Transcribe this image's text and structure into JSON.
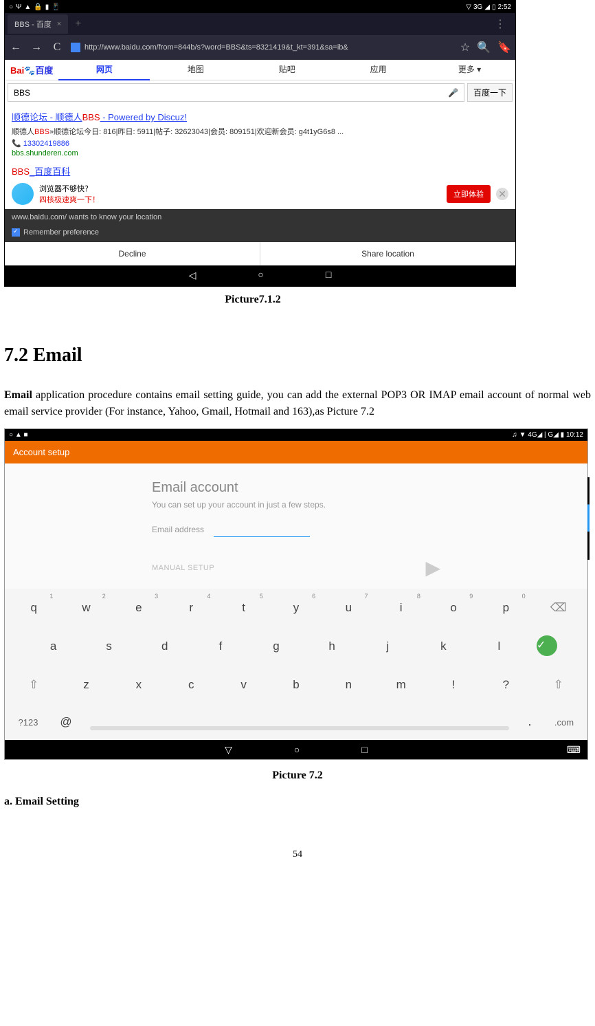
{
  "screenshot1": {
    "status": {
      "time": "2:52",
      "network": "3G",
      "icons_left": [
        "o-icon",
        "psi-icon",
        "warn-icon",
        "lock-icon",
        "battery-icon",
        "phone-icon"
      ]
    },
    "tab": {
      "title": "BBS - 百度",
      "close": "×",
      "new": "+",
      "menu": "⋮"
    },
    "url": {
      "back": "←",
      "forward": "→",
      "reload": "C",
      "text": "http://www.baidu.com/from=844b/s?word=BBS&ts=8321419&t_kt=391&sa=ib&",
      "star": "☆",
      "search": "🔍",
      "bookmark": "🔖"
    },
    "baidu": {
      "logo": {
        "bai": "Bai",
        "du": "百度",
        "paw": "🐾"
      },
      "nav": [
        "网页",
        "地图",
        "贴吧",
        "应用",
        "更多"
      ],
      "more_arrow": "▾",
      "search_value": "BBS",
      "mic": "🎤",
      "search_btn": "百度一下"
    },
    "result1": {
      "title_p1": "顺德论坛 - 顺德人",
      "title_red": "BBS",
      "title_p2": " - Powered by Discuz!",
      "snippet_pre": "顺德人",
      "snippet_red": "BBS",
      "snippet_post": "»顺德论坛今日: 816|昨日: 5911|帖子: 32623043|会员: 809151|欢迎新会员: g4t1yG6s8 ...",
      "phone": "13302419886",
      "url": "bbs.shunderen.com"
    },
    "result2": {
      "red": "BBS",
      "blue": "_百度百科"
    },
    "promo": {
      "line1": "浏览器不够快？",
      "line2": "四核极速爽一下！",
      "btn": "立即体验",
      "close": "✕"
    },
    "location": {
      "text": "www.baidu.com/ wants to know your location",
      "pref": "Remember preference",
      "decline": "Decline",
      "share": "Share location"
    },
    "nav": {
      "back": "◁",
      "home": "○",
      "recent": "□"
    }
  },
  "caption1": "Picture7.1.2",
  "heading": "7.2 Email",
  "body": {
    "strong": "Email",
    "rest": " application procedure contains email setting guide, you can add the external POP3 OR IMAP email account of normal web email service provider (For instance, Yahoo, Gmail, Hotmail and 163),as Picture 7.2"
  },
  "screenshot2": {
    "status": {
      "left_icons": "○ ▲ ■",
      "right": "♫ ▼ 4G◢ | G◢ ▮ 10:12"
    },
    "header": "Account setup",
    "card": {
      "title": "Email account",
      "sub": "You can set up your account in just a few steps.",
      "field": "Email address",
      "manual": "MANUAL SETUP",
      "next": "▶"
    },
    "keyboard": {
      "row1": [
        {
          "k": "q",
          "n": "1"
        },
        {
          "k": "w",
          "n": "2"
        },
        {
          "k": "e",
          "n": "3"
        },
        {
          "k": "r",
          "n": "4"
        },
        {
          "k": "t",
          "n": "5"
        },
        {
          "k": "y",
          "n": "6"
        },
        {
          "k": "u",
          "n": "7"
        },
        {
          "k": "i",
          "n": "8"
        },
        {
          "k": "o",
          "n": "9"
        },
        {
          "k": "p",
          "n": "0"
        }
      ],
      "backspace": "⌫",
      "row2": [
        "a",
        "s",
        "d",
        "f",
        "g",
        "h",
        "j",
        "k",
        "l"
      ],
      "enter": "✓",
      "shift": "⇧",
      "row3": [
        "z",
        "x",
        "c",
        "v",
        "b",
        "n",
        "m",
        "!",
        "?"
      ],
      "shift2": "⇧",
      "special": "?123",
      "at": "@",
      "dot": ".",
      "com": ".com"
    },
    "nav": {
      "back": "▽",
      "home": "○",
      "recent": "□",
      "kb": "⌨"
    }
  },
  "caption2": "Picture 7.2",
  "subheading": "a. Email Setting",
  "page": "54"
}
